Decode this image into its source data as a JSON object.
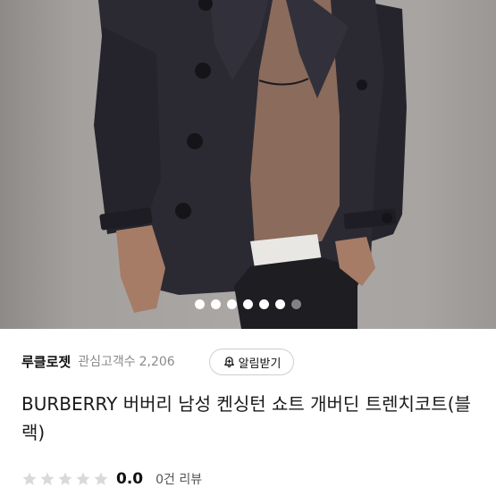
{
  "gallery": {
    "image_description_icon": "product-photo",
    "dots_total": 7,
    "active_dot": 0
  },
  "seller": {
    "name": "루클로젯",
    "followers_label": "관심고객수",
    "followers_count": "2,206",
    "alert_button_label": "알림받기",
    "alert_icon": "bell-plus-icon"
  },
  "product": {
    "title": "BURBERRY 버버리 남성 켄싱턴 쇼트 개버딘 트렌치코트(블랙)"
  },
  "rating": {
    "stars_max": 5,
    "stars_filled": 0,
    "score": "0.0",
    "reviews_label": "0건 리뷰"
  },
  "colors": {
    "star_empty": "#d9d9d9",
    "coat": "#2a2932",
    "sweater": "#8a6b5c"
  }
}
